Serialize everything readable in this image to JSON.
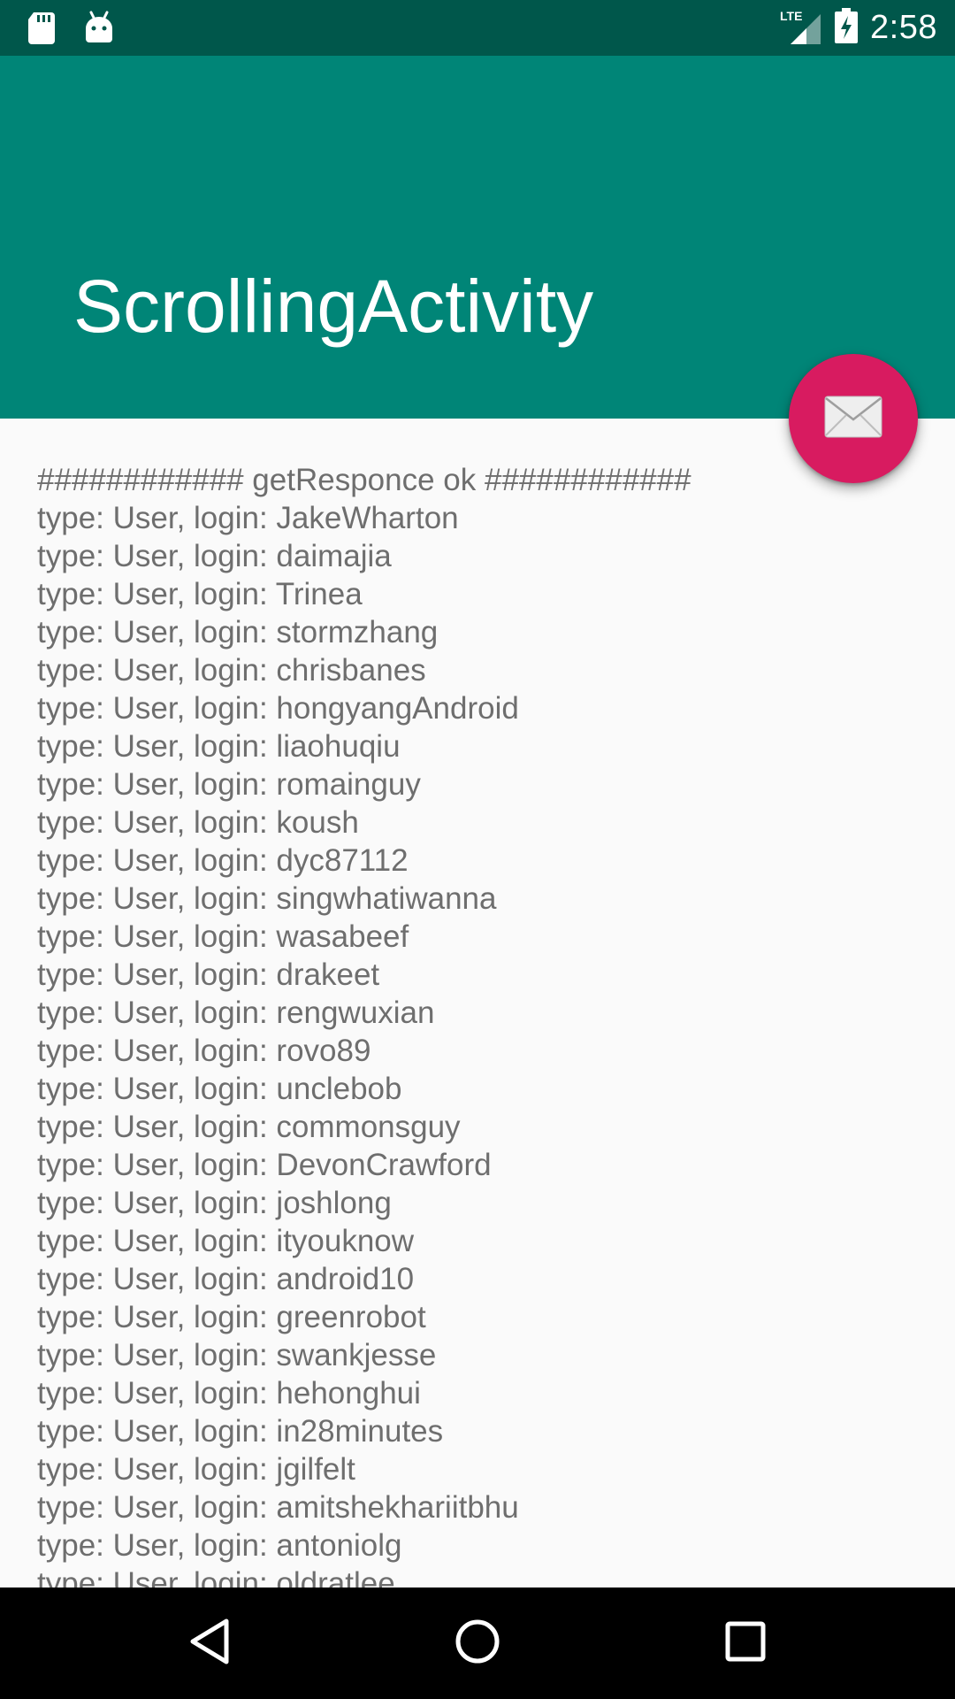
{
  "status_bar": {
    "time": "2:58",
    "network_label": "LTE",
    "left_icons": [
      "sd-card-icon",
      "android-icon"
    ],
    "right_icons": [
      "lte-signal-icon",
      "battery-charging-icon"
    ]
  },
  "app_bar": {
    "title": "ScrollingActivity",
    "color": "#008577",
    "status_color": "#00574b"
  },
  "fab": {
    "icon": "email-icon",
    "color": "#d81b60"
  },
  "content": {
    "lines": [
      "############ getResponce ok ############",
      "type: User, login: JakeWharton",
      "type: User, login: daimajia",
      "type: User, login: Trinea",
      "type: User, login: stormzhang",
      "type: User, login: chrisbanes",
      "type: User, login: hongyangAndroid",
      "type: User, login: liaohuqiu",
      "type: User, login: romainguy",
      "type: User, login: koush",
      "type: User, login: dyc87112",
      "type: User, login: singwhatiwanna",
      "type: User, login: wasabeef",
      "type: User, login: drakeet",
      "type: User, login: rengwuxian",
      "type: User, login: rovo89",
      "type: User, login: unclebob",
      "type: User, login: commonsguy",
      "type: User, login: DevonCrawford",
      "type: User, login: joshlong",
      "type: User, login: ityouknow",
      "type: User, login: android10",
      "type: User, login: greenrobot",
      "type: User, login: swankjesse",
      "type: User, login: hehonghui",
      "type: User, login: in28minutes",
      "type: User, login: jgilfelt",
      "type: User, login: amitshekhariitbhu",
      "type: User, login: antoniolg",
      "type: User, login: oldratlee"
    ]
  },
  "nav_bar": {
    "buttons": [
      "back-icon",
      "home-icon",
      "recents-icon"
    ]
  }
}
